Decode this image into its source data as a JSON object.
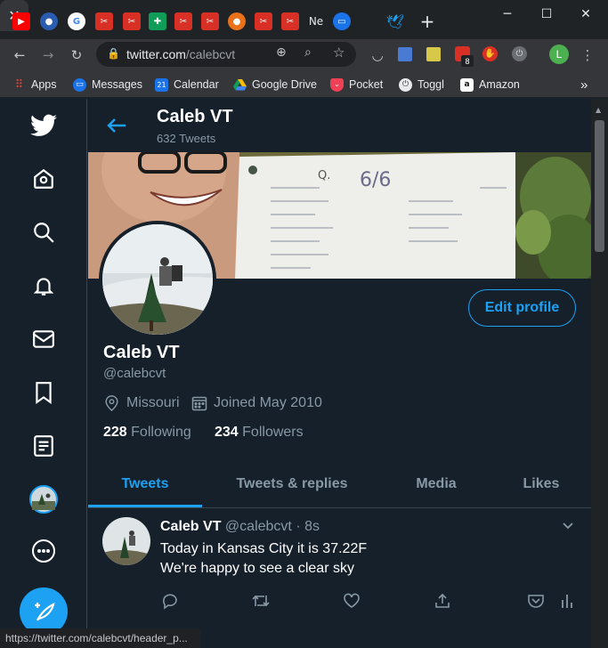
{
  "browser": {
    "tabs_pinned": [
      "youtube-icon",
      "firefox-icon",
      "google-icon",
      "red-c-icon",
      "red-c-icon",
      "green-plus-icon",
      "red-c-icon",
      "red-c-icon",
      "orange-ball-icon",
      "red-c-icon",
      "red-c-icon"
    ],
    "tab_ne_label": "Ne",
    "active_tab_close": "✕",
    "new_tab": "+",
    "url_host": "twitter.com",
    "url_path": "/calebcvt",
    "bookmarks": [
      {
        "label": "Apps",
        "icon": "apps-grid-icon"
      },
      {
        "label": "Messages",
        "icon": "messages-icon"
      },
      {
        "label": "Calendar",
        "icon": "calendar-icon",
        "icon_text": "21"
      },
      {
        "label": "Google Drive",
        "icon": "drive-icon"
      },
      {
        "label": "Pocket",
        "icon": "pocket-icon"
      },
      {
        "label": "Toggl",
        "icon": "toggl-icon"
      },
      {
        "label": "Amazon",
        "icon": "amazon-icon",
        "icon_text": "a"
      }
    ],
    "extension_badge": "8",
    "profile_initial": "L",
    "more_bookmarks": "»"
  },
  "profile": {
    "header_name": "Caleb VT",
    "tweet_count": "632 Tweets",
    "name": "Caleb VT",
    "handle": "@calebcvt",
    "location": "Missouri",
    "joined": "Joined May 2010",
    "following_count": "228",
    "following_label": "Following",
    "followers_count": "234",
    "followers_label": "Followers",
    "edit_profile": "Edit profile",
    "banner_note": "6/6"
  },
  "tabs": [
    {
      "label": "Tweets",
      "active": true
    },
    {
      "label": "Tweets & replies",
      "active": false
    },
    {
      "label": "Media",
      "active": false
    },
    {
      "label": "Likes",
      "active": false
    }
  ],
  "tweet": {
    "name": "Caleb VT",
    "handle": "@calebcvt",
    "dot": "·",
    "time": "8s",
    "line1": "Today in Kansas City it is 37.22F",
    "line2": "We're happy to see a clear sky"
  },
  "status_url": "https://twitter.com/calebcvt/header_p...",
  "colors": {
    "accent": "#1da1f2",
    "bg": "#15202b",
    "muted": "#8899a6",
    "border": "#38444d"
  }
}
